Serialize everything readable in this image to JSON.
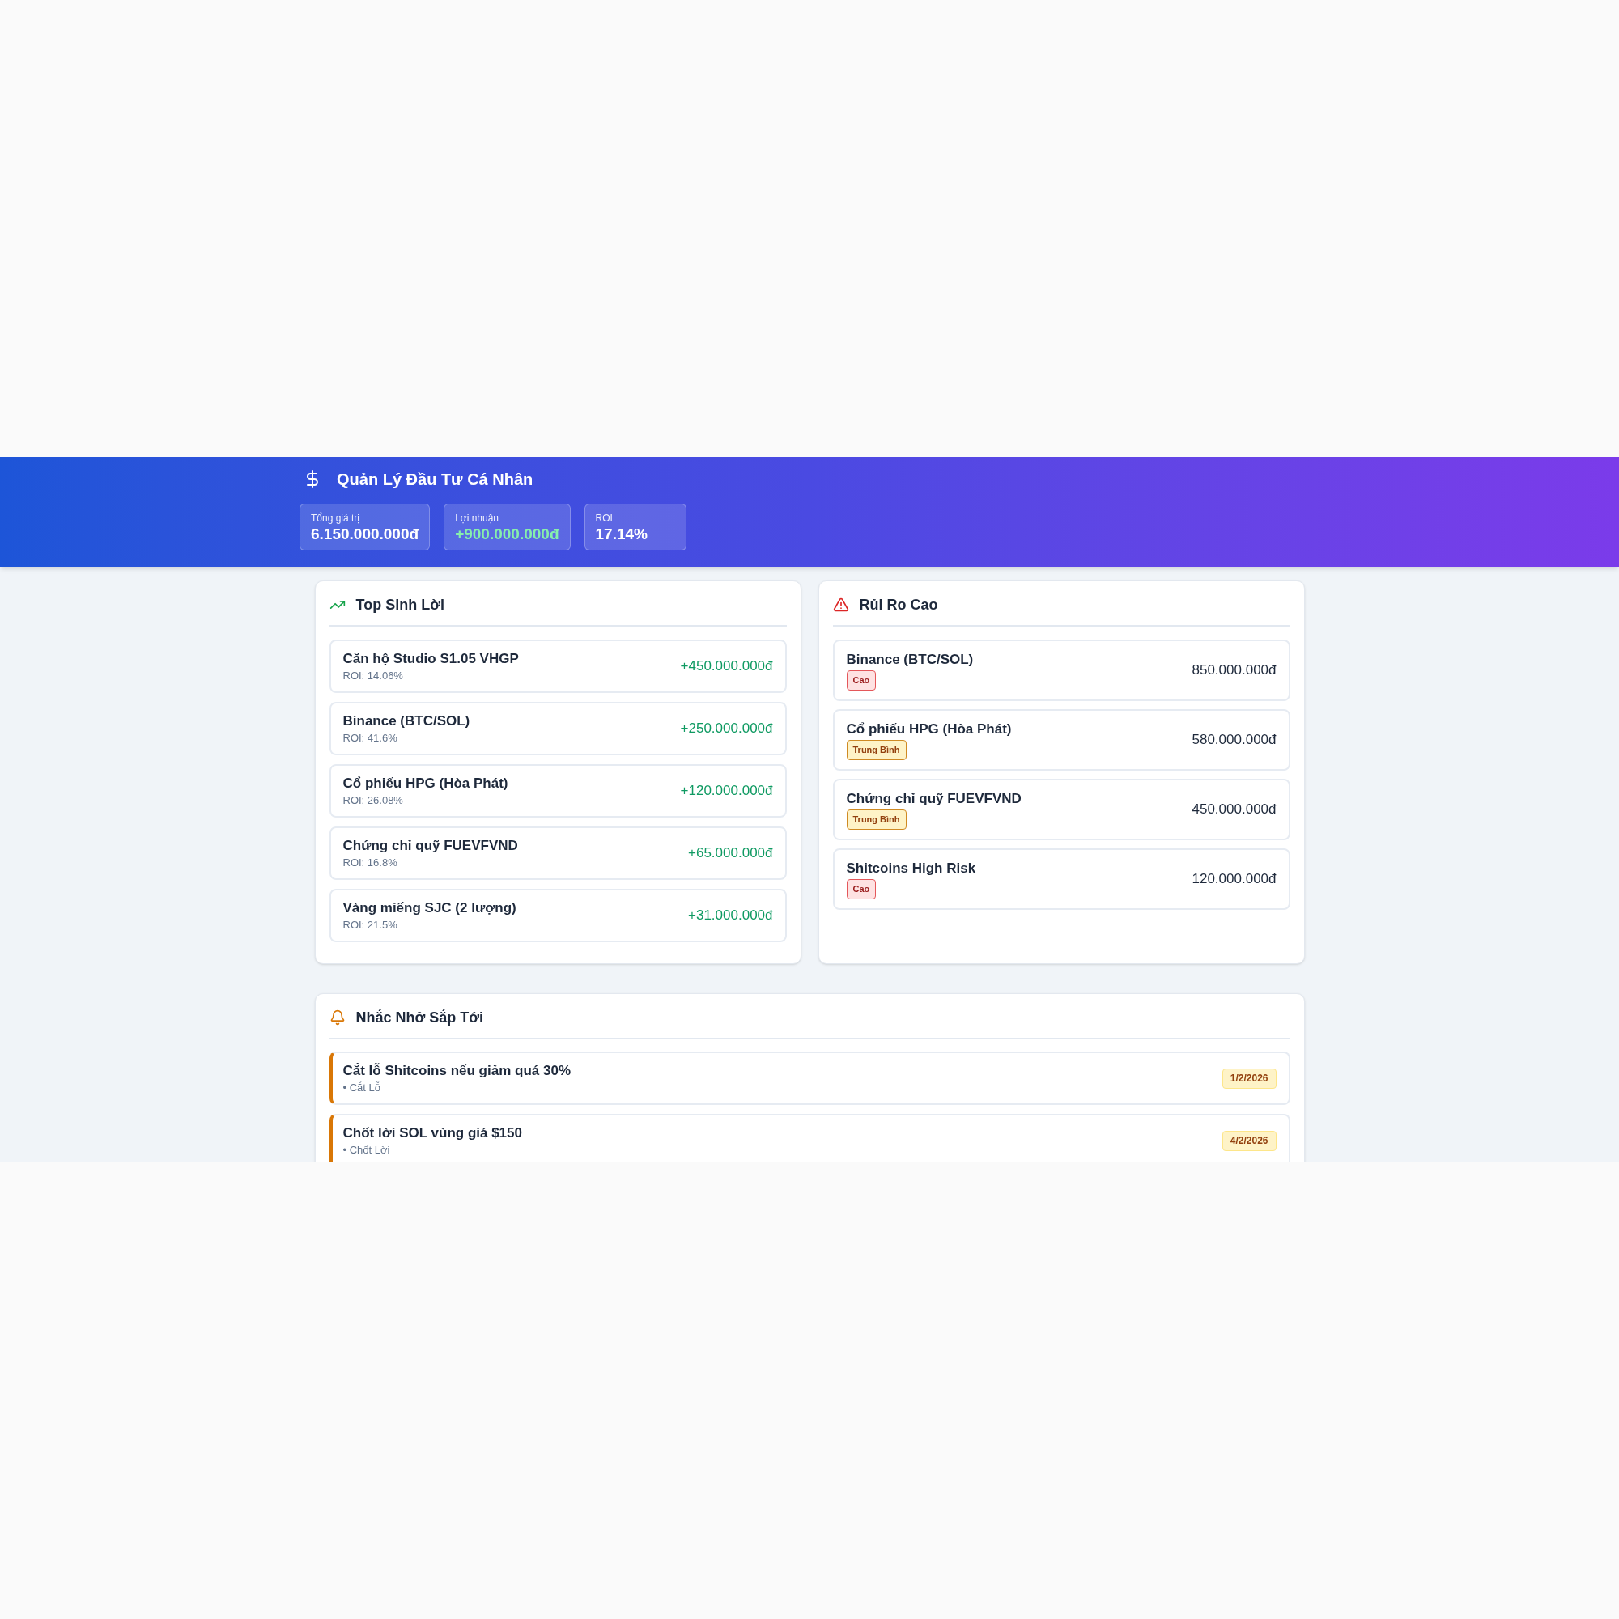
{
  "header": {
    "title": "Quản Lý Đầu Tư Cá Nhân",
    "stats": [
      {
        "label": "Tổng giá trị",
        "value": "6.150.000.000đ",
        "kind": "plain"
      },
      {
        "label": "Lợi nhuận",
        "value": "+900.000.000đ",
        "kind": "positive"
      },
      {
        "label": "ROI",
        "value": "17.14%",
        "kind": "plain"
      }
    ]
  },
  "top_profit": {
    "title": "Top Sinh Lời",
    "items": [
      {
        "name": "Căn hộ Studio S1.05 VHGP",
        "roi": "ROI: 14.06%",
        "profit": "+450.000.000đ"
      },
      {
        "name": "Binance (BTC/SOL)",
        "roi": "ROI: 41.6%",
        "profit": "+250.000.000đ"
      },
      {
        "name": "Cổ phiếu HPG (Hòa Phát)",
        "roi": "ROI: 26.08%",
        "profit": "+120.000.000đ"
      },
      {
        "name": "Chứng chỉ quỹ FUEVFVND",
        "roi": "ROI: 16.8%",
        "profit": "+65.000.000đ"
      },
      {
        "name": "Vàng miếng SJC (2 lượng)",
        "roi": "ROI: 21.5%",
        "profit": "+31.000.000đ"
      }
    ]
  },
  "high_risk": {
    "title": "Rủi Ro Cao",
    "items": [
      {
        "name": "Binance (BTC/SOL)",
        "risk": "Cao",
        "kind": "high",
        "value": "850.000.000đ"
      },
      {
        "name": "Cổ phiếu HPG (Hòa Phát)",
        "risk": "Trung Bình",
        "kind": "medium",
        "value": "580.000.000đ"
      },
      {
        "name": "Chứng chỉ quỹ FUEVFVND",
        "risk": "Trung Bình",
        "kind": "medium",
        "value": "450.000.000đ"
      },
      {
        "name": "Shitcoins High Risk",
        "risk": "Cao",
        "kind": "high",
        "value": "120.000.000đ"
      }
    ]
  },
  "reminders": {
    "title": "Nhắc Nhở Sắp Tới",
    "items": [
      {
        "title": "Cắt lỗ Shitcoins nếu giảm quá 30%",
        "category": "• Cắt Lỗ",
        "date": "1/2/2026"
      },
      {
        "title": "Chốt lời SOL vùng giá $150",
        "category": "• Chốt Lời",
        "date": "4/2/2026"
      }
    ]
  }
}
